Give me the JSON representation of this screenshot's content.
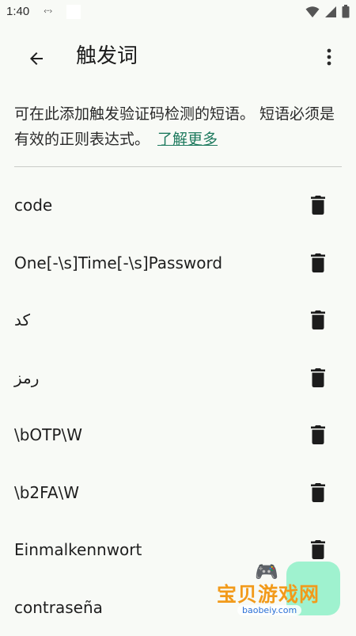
{
  "status_bar": {
    "time": "1:40",
    "dots": "‹··›"
  },
  "app_bar": {
    "title": "触发词"
  },
  "description": {
    "text": "可在此添加触发验证码检测的短语。 短语必须是有效的正则表达式。",
    "link_label": "了解更多"
  },
  "phrases": [
    {
      "text": "code"
    },
    {
      "text": "One[-\\s]Time[-\\s]Password"
    },
    {
      "text": "كد"
    },
    {
      "text": "رمز"
    },
    {
      "text": "\\bOTP\\W"
    },
    {
      "text": "\\b2FA\\W"
    },
    {
      "text": "Einmalkennwort"
    },
    {
      "text": "contraseña"
    }
  ],
  "watermark": {
    "text": "宝贝游戏网",
    "domain": "baobeiy.com"
  },
  "colors": {
    "background": "#f8faf6",
    "link": "#1e7a5e",
    "fab": "#9ff2cf"
  },
  "icons": {
    "back": "arrow-back-icon",
    "menu": "more-vert-icon",
    "delete": "trash-icon"
  }
}
